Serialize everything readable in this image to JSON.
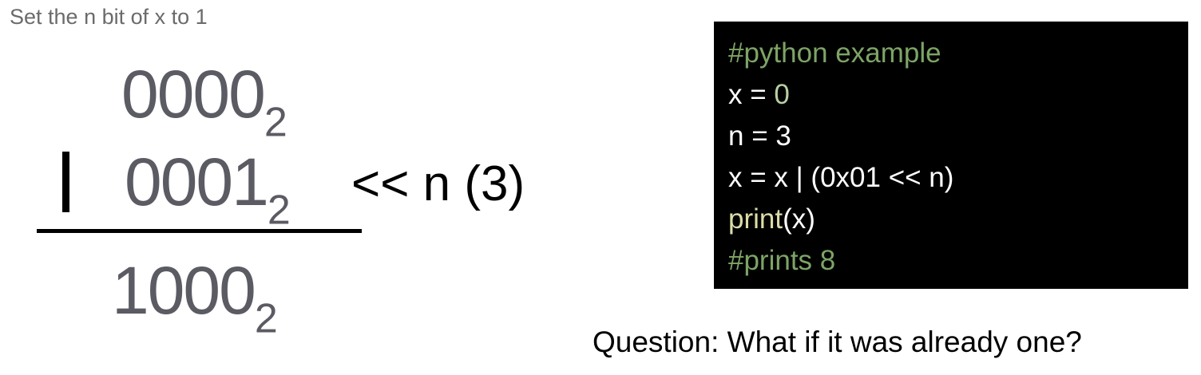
{
  "subtitle": "Set the n bit of x to  1",
  "operation": {
    "row1": {
      "bits": "0000",
      "base": "2"
    },
    "operator": "|",
    "row2": {
      "bits": "0001",
      "base": "2"
    },
    "shift_label": "<< n (3)",
    "result": {
      "bits": "1000",
      "base": "2"
    }
  },
  "code": {
    "lines": [
      {
        "comment": "#python example"
      },
      {
        "pre": "x = ",
        "num": "0"
      },
      {
        "pre": "n = 3"
      },
      {
        "pre": "x = x | (0x01 << n)"
      },
      {
        "func": "print",
        "post": "(x)"
      },
      {
        "comment": "#prints 8"
      }
    ]
  },
  "question": "Question: What if it was already one?",
  "colors": {
    "comment": "#7da466",
    "number": "#b7cfa4",
    "function": "#dcdcaa",
    "code_text": "#ffffff",
    "code_background": "#000000",
    "binary_text": "#5b5b63"
  }
}
